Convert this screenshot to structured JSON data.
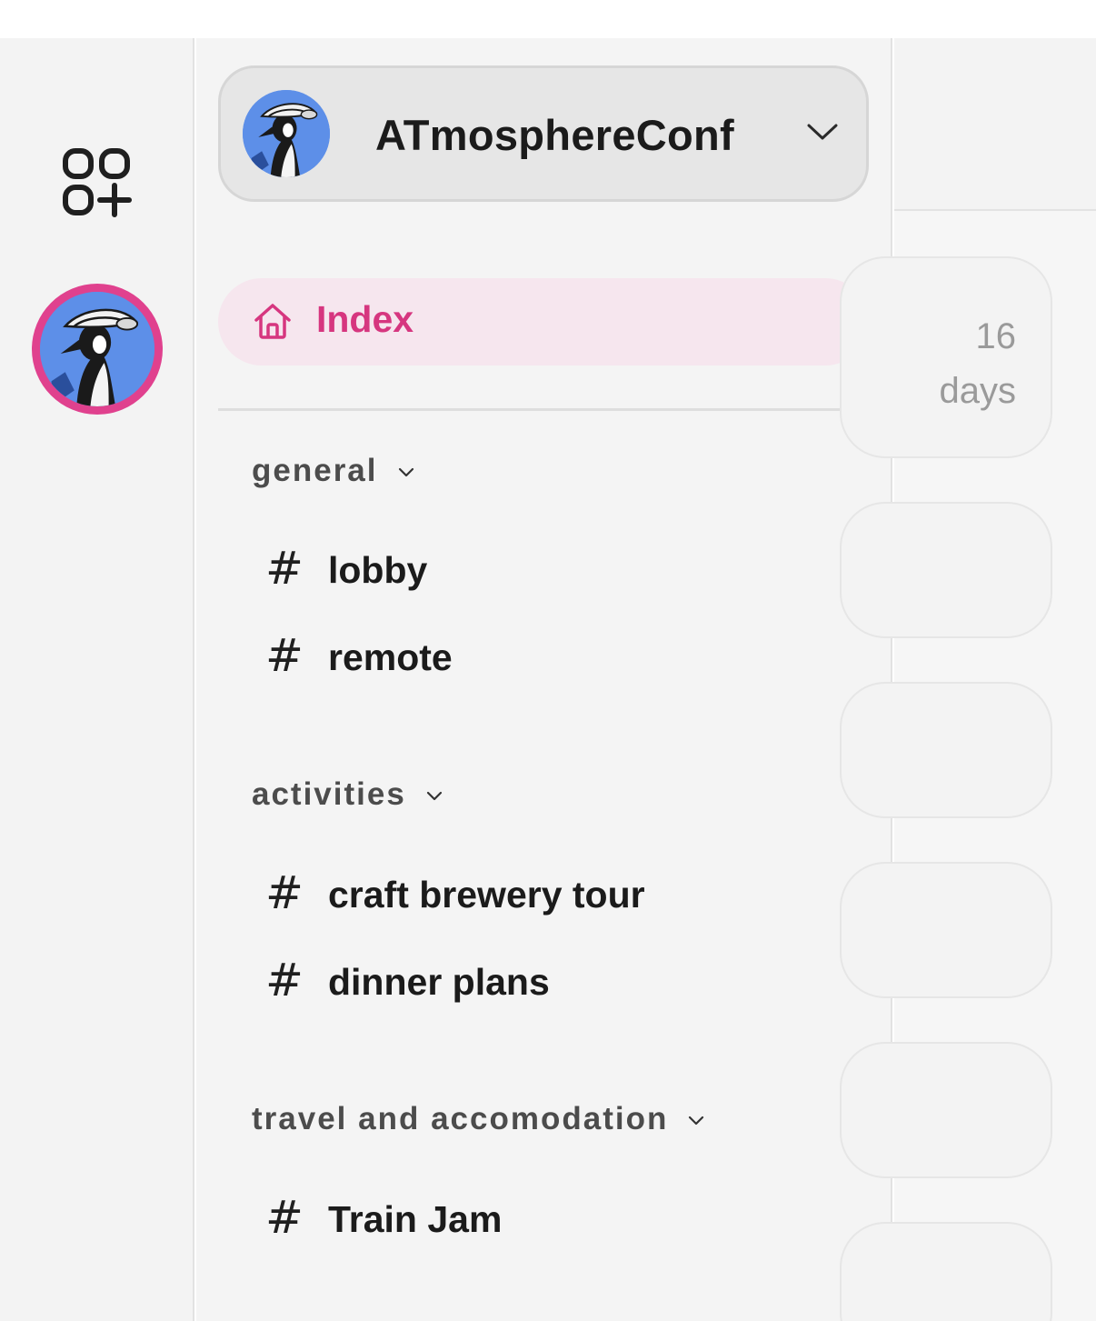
{
  "space": {
    "name": "ATmosphereConf"
  },
  "nav": {
    "index_label": "Index"
  },
  "sections": [
    {
      "label": "general",
      "channels": [
        "lobby",
        "remote"
      ]
    },
    {
      "label": "activities",
      "channels": [
        "craft brewery tour",
        "dinner plans"
      ]
    },
    {
      "label": "travel and accomodation",
      "channels": [
        "Train Jam"
      ]
    }
  ],
  "main": {
    "first_card_time_value": "16",
    "first_card_time_unit": "days"
  },
  "icons": {
    "add_space": "add-space-icon",
    "home": "home-icon",
    "hash": "#",
    "chevron": "chevron-down-icon"
  },
  "colors": {
    "accent": "#d6367f",
    "accent_bg": "#f6e6ee",
    "avatar_ring": "#e0418e",
    "avatar_bg": "#5d8fe8"
  }
}
